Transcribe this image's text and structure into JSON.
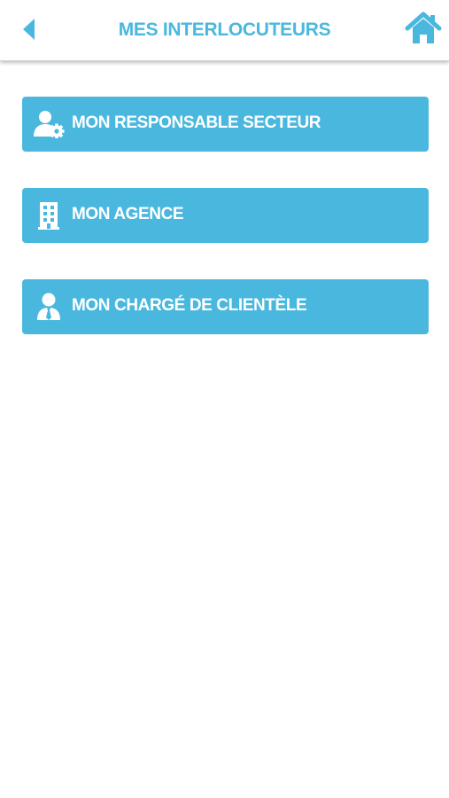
{
  "header": {
    "title": "MES INTERLOCUTEURS",
    "back_icon": "chevron-left-icon",
    "home_icon": "home-icon"
  },
  "colors": {
    "accent": "#4ab8de",
    "text_on_accent": "#ffffff",
    "background": "#ffffff"
  },
  "menu": {
    "items": [
      {
        "label": "MON RESPONSABLE SECTEUR",
        "icon": "user-gear-icon"
      },
      {
        "label": "MON AGENCE",
        "icon": "building-icon"
      },
      {
        "label": "MON CHARGÉ DE CLIENTÈLE",
        "icon": "user-tie-icon"
      }
    ]
  }
}
